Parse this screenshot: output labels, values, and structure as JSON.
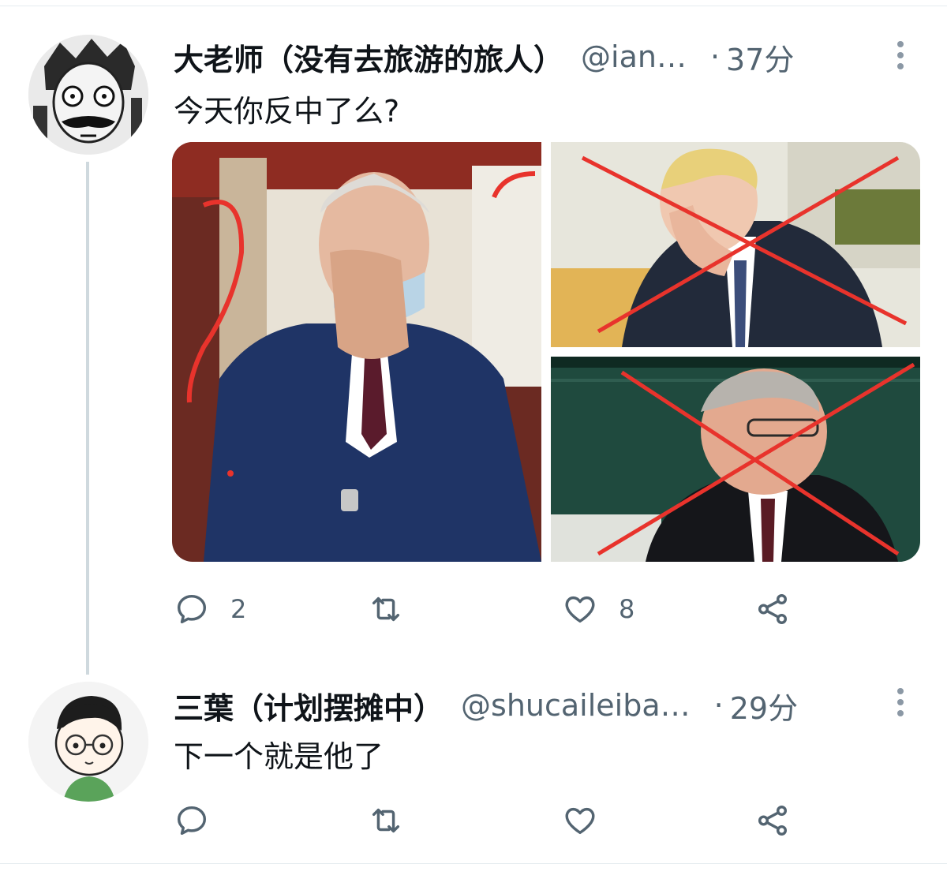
{
  "tweets": [
    {
      "display_name": "大老师（没有去旅游的旅人）",
      "handle": "@ian…",
      "separator": "·",
      "time": "37分",
      "text": "今天你反中了么?",
      "actions": {
        "reply_count": "2",
        "retweet_count": "",
        "like_count": "8"
      }
    },
    {
      "display_name": "三葉（计划摆摊中）",
      "handle": "@shucaileiba…",
      "separator": "·",
      "time": "29分",
      "text": "下一个就是他了",
      "actions": {
        "reply_count": "",
        "retweet_count": "",
        "like_count": ""
      }
    }
  ],
  "colors": {
    "text_primary": "#0f1419",
    "text_secondary": "#536471",
    "thread_line": "#cfd9de",
    "annotation_red": "#e8332c"
  },
  "icons": [
    "reply-icon",
    "retweet-icon",
    "like-icon",
    "share-icon",
    "more-icon"
  ]
}
